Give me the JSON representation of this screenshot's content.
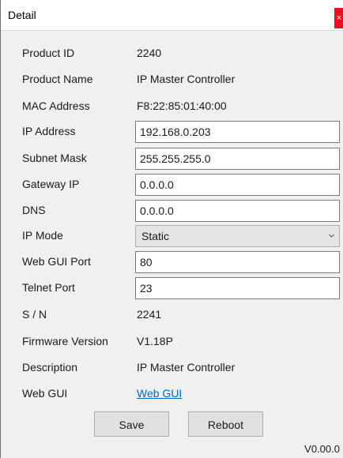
{
  "window": {
    "title": "Detail",
    "close_glyph": "×"
  },
  "fields": {
    "product_id": {
      "label": "Product ID",
      "value": "2240"
    },
    "product_name": {
      "label": "Product Name",
      "value": "IP Master Controller"
    },
    "mac_address": {
      "label": "MAC Address",
      "value": "F8:22:85:01:40:00"
    },
    "ip_address": {
      "label": "IP Address",
      "value": "192.168.0.203"
    },
    "subnet_mask": {
      "label": "Subnet Mask",
      "value": "255.255.255.0"
    },
    "gateway_ip": {
      "label": "Gateway IP",
      "value": "0.0.0.0"
    },
    "dns": {
      "label": "DNS",
      "value": "0.0.0.0"
    },
    "ip_mode": {
      "label": "IP Mode",
      "value": "Static"
    },
    "web_gui_port": {
      "label": "Web GUI Port",
      "value": "80"
    },
    "telnet_port": {
      "label": "Telnet Port",
      "value": "23"
    },
    "serial_number": {
      "label": "S / N",
      "value": "2241"
    },
    "firmware_version": {
      "label": "Firmware Version",
      "value": "V1.18P"
    },
    "description": {
      "label": "Description",
      "value": "IP Master Controller"
    },
    "web_gui": {
      "label": "Web GUI",
      "link_text": "Web GUI"
    }
  },
  "buttons": {
    "save": "Save",
    "reboot": "Reboot"
  },
  "footer": {
    "version": "V0.00.0"
  },
  "colors": {
    "close": "#e81123",
    "link": "#0066cc"
  }
}
